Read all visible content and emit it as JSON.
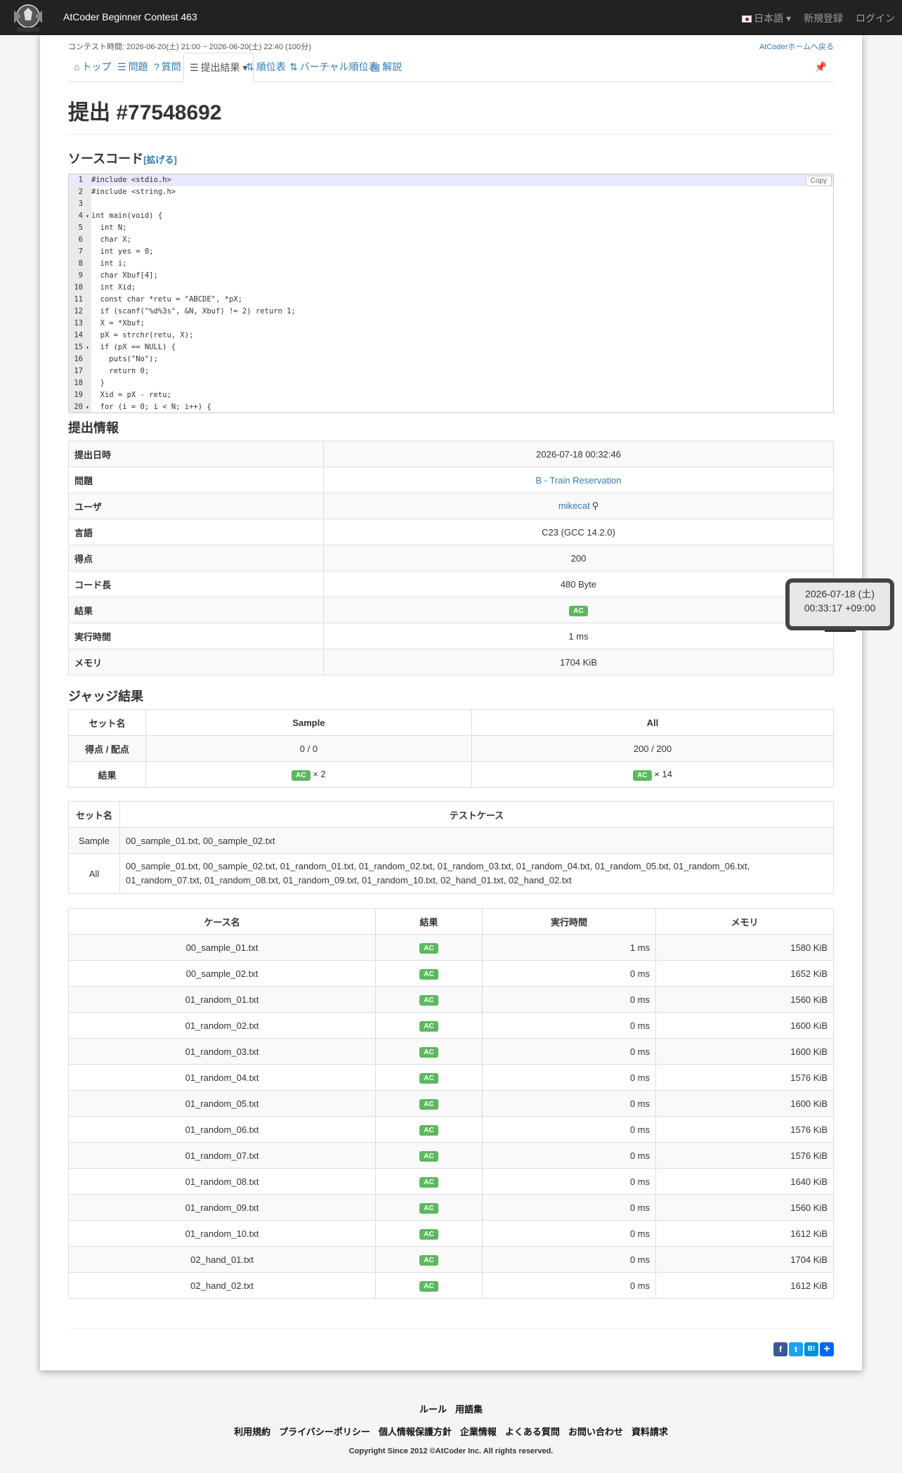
{
  "header": {
    "contest_title": "AtCoder Beginner Contest 463",
    "language": "日本語",
    "register": "新規登録",
    "login": "ログイン"
  },
  "contest_time": "コンテスト時間: 2026-06-20(土) 21:00 ~ 2026-06-20(土) 22:40 (100分)",
  "home_link": "AtCoderホームへ戻る",
  "nav": [
    {
      "label": "トップ",
      "icon": "home-icon"
    },
    {
      "label": "問題",
      "icon": "list-icon"
    },
    {
      "label": "質問",
      "icon": "question-icon"
    },
    {
      "label": "提出結果",
      "icon": "list-alt-icon",
      "active": true
    },
    {
      "label": "順位表",
      "icon": "sort-icon"
    },
    {
      "label": "バーチャル順位表",
      "icon": "sort-icon"
    },
    {
      "label": "解説",
      "icon": "book-icon"
    }
  ],
  "page_title": "提出 #77548692",
  "source": {
    "heading": "ソースコード",
    "expand": "[拡げる]",
    "copy": "Copy",
    "lines": [
      "#include <stdio.h>",
      "#include <string.h>",
      "",
      "int main(void) {",
      "  int N;",
      "  char X;",
      "  int yes = 0;",
      "  int i;",
      "  char Xbuf[4];",
      "  int Xid;",
      "  const char *retu = \"ABCDE\", *pX;",
      "  if (scanf(\"%d%3s\", &N, Xbuf) != 2) return 1;",
      "  X = *Xbuf;",
      "  pX = strchr(retu, X);",
      "  if (pX == NULL) {",
      "    puts(\"No\");",
      "    return 0;",
      "  }",
      "  Xid = pX - retu;",
      "  for (i = 0; i < N; i++) {"
    ],
    "fold_lines": [
      4,
      15,
      20
    ]
  },
  "info": {
    "heading": "提出情報",
    "rows": [
      {
        "k": "提出日時",
        "v": "2026-07-18 00:32:46"
      },
      {
        "k": "問題",
        "v": "B - Train Reservation",
        "link": true
      },
      {
        "k": "ユーザ",
        "v": "mikecat",
        "link": true,
        "search": true
      },
      {
        "k": "言語",
        "v": "C23 (GCC 14.2.0)"
      },
      {
        "k": "得点",
        "v": "200"
      },
      {
        "k": "コード長",
        "v": "480 Byte"
      },
      {
        "k": "結果",
        "v": "AC",
        "badge": true
      },
      {
        "k": "実行時間",
        "v": "1 ms"
      },
      {
        "k": "メモリ",
        "v": "1704 KiB"
      }
    ]
  },
  "tooltip": {
    "line1": "2026-07-18 (土)",
    "line2": "00:33:17 +09:00"
  },
  "judge": {
    "heading": "ジャッジ結果",
    "headers": [
      "セット名",
      "Sample",
      "All"
    ],
    "score_label": "得点 / 配点",
    "scores": [
      "0 / 0",
      "200 / 200"
    ],
    "result_label": "結果",
    "results": [
      {
        "badge": "AC",
        "count": "× 2"
      },
      {
        "badge": "AC",
        "count": "× 14"
      }
    ]
  },
  "testsets": {
    "headers": [
      "セット名",
      "テストケース"
    ],
    "rows": [
      {
        "name": "Sample",
        "cases": "00_sample_01.txt, 00_sample_02.txt"
      },
      {
        "name": "All",
        "cases": "00_sample_01.txt, 00_sample_02.txt, 01_random_01.txt, 01_random_02.txt, 01_random_03.txt, 01_random_04.txt, 01_random_05.txt, 01_random_06.txt, 01_random_07.txt, 01_random_08.txt, 01_random_09.txt, 01_random_10.txt, 02_hand_01.txt, 02_hand_02.txt"
      }
    ]
  },
  "cases": {
    "headers": [
      "ケース名",
      "結果",
      "実行時間",
      "メモリ"
    ],
    "rows": [
      {
        "name": "00_sample_01.txt",
        "res": "AC",
        "time": "1 ms",
        "mem": "1580 KiB"
      },
      {
        "name": "00_sample_02.txt",
        "res": "AC",
        "time": "0 ms",
        "mem": "1652 KiB"
      },
      {
        "name": "01_random_01.txt",
        "res": "AC",
        "time": "0 ms",
        "mem": "1560 KiB"
      },
      {
        "name": "01_random_02.txt",
        "res": "AC",
        "time": "0 ms",
        "mem": "1600 KiB"
      },
      {
        "name": "01_random_03.txt",
        "res": "AC",
        "time": "0 ms",
        "mem": "1600 KiB"
      },
      {
        "name": "01_random_04.txt",
        "res": "AC",
        "time": "0 ms",
        "mem": "1576 KiB"
      },
      {
        "name": "01_random_05.txt",
        "res": "AC",
        "time": "0 ms",
        "mem": "1600 KiB"
      },
      {
        "name": "01_random_06.txt",
        "res": "AC",
        "time": "0 ms",
        "mem": "1576 KiB"
      },
      {
        "name": "01_random_07.txt",
        "res": "AC",
        "time": "0 ms",
        "mem": "1576 KiB"
      },
      {
        "name": "01_random_08.txt",
        "res": "AC",
        "time": "0 ms",
        "mem": "1640 KiB"
      },
      {
        "name": "01_random_09.txt",
        "res": "AC",
        "time": "0 ms",
        "mem": "1560 KiB"
      },
      {
        "name": "01_random_10.txt",
        "res": "AC",
        "time": "0 ms",
        "mem": "1612 KiB"
      },
      {
        "name": "02_hand_01.txt",
        "res": "AC",
        "time": "0 ms",
        "mem": "1704 KiB"
      },
      {
        "name": "02_hand_02.txt",
        "res": "AC",
        "time": "0 ms",
        "mem": "1612 KiB"
      }
    ]
  },
  "footer": {
    "row1": [
      "ルール",
      "用語集"
    ],
    "row2": [
      "利用規約",
      "プライバシーポリシー",
      "個人情報保護方針",
      "企業情報",
      "よくある質問",
      "お問い合わせ",
      "資料請求"
    ],
    "copyright": "Copyright Since 2012 ©AtCoder Inc. All rights reserved."
  },
  "colors": {
    "ac": "#5cb85c",
    "link": "#337ab7",
    "topbar": "#222222"
  }
}
